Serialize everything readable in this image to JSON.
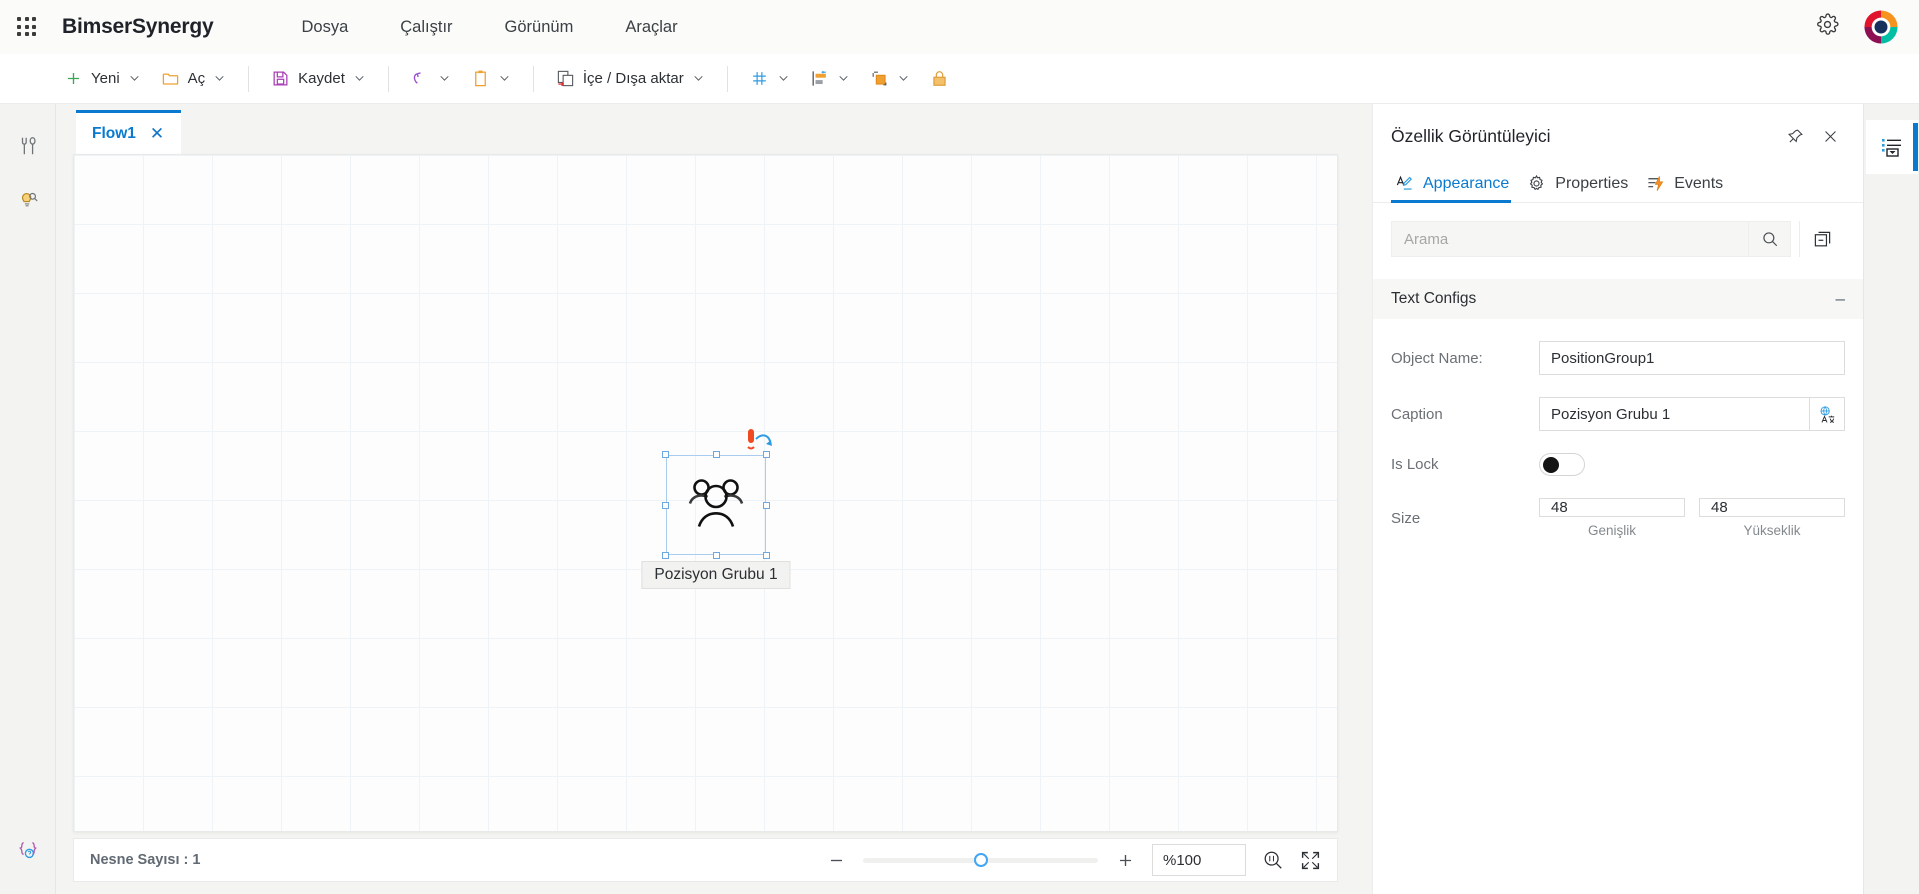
{
  "app": {
    "brand": "BimserSynergy",
    "menu": [
      "Dosya",
      "Çalıştır",
      "Görünüm",
      "Araçlar"
    ]
  },
  "toolbar": {
    "new_label": "Yeni",
    "open_label": "Aç",
    "save_label": "Kaydet",
    "import_export_label": "İçe / Dışa aktar"
  },
  "editor": {
    "tab_label": "Flow1",
    "tab_close": "✕",
    "node": {
      "label": "Pozisyon Grubu 1"
    }
  },
  "status": {
    "object_count": "Nesne Sayısı : 1",
    "zoom_value": "%100"
  },
  "panel": {
    "title": "Özellik Görüntüleyici",
    "tabs": [
      {
        "label": "Appearance",
        "icon": "appearance-icon",
        "active": true
      },
      {
        "label": "Properties",
        "icon": "gear-icon",
        "active": false
      },
      {
        "label": "Events",
        "icon": "events-icon",
        "active": false
      }
    ],
    "search": {
      "value": "",
      "placeholder": "Arama"
    },
    "section": {
      "title": "Text Configs",
      "toggle": "–"
    },
    "fields": {
      "object_name_label": "Object Name:",
      "object_name_value": "PositionGroup1",
      "caption_label": "Caption",
      "caption_value": "Pozisyon Grubu 1",
      "is_lock_label": "Is Lock",
      "is_lock_value": "off",
      "size_label": "Size",
      "width_value": "48",
      "height_value": "48",
      "width_caption": "Genişlik",
      "height_caption": "Yükseklik"
    }
  },
  "colors": {
    "accent": "#0a7ad1",
    "toolbar_new": "#3aa757",
    "toolbar_open": "#f0a030",
    "toolbar_save": "#a93fb5",
    "toolbar_undo": "#9b4fd0",
    "panel_bg": "#ffffff",
    "canvas_grid": "#eef3f7"
  }
}
